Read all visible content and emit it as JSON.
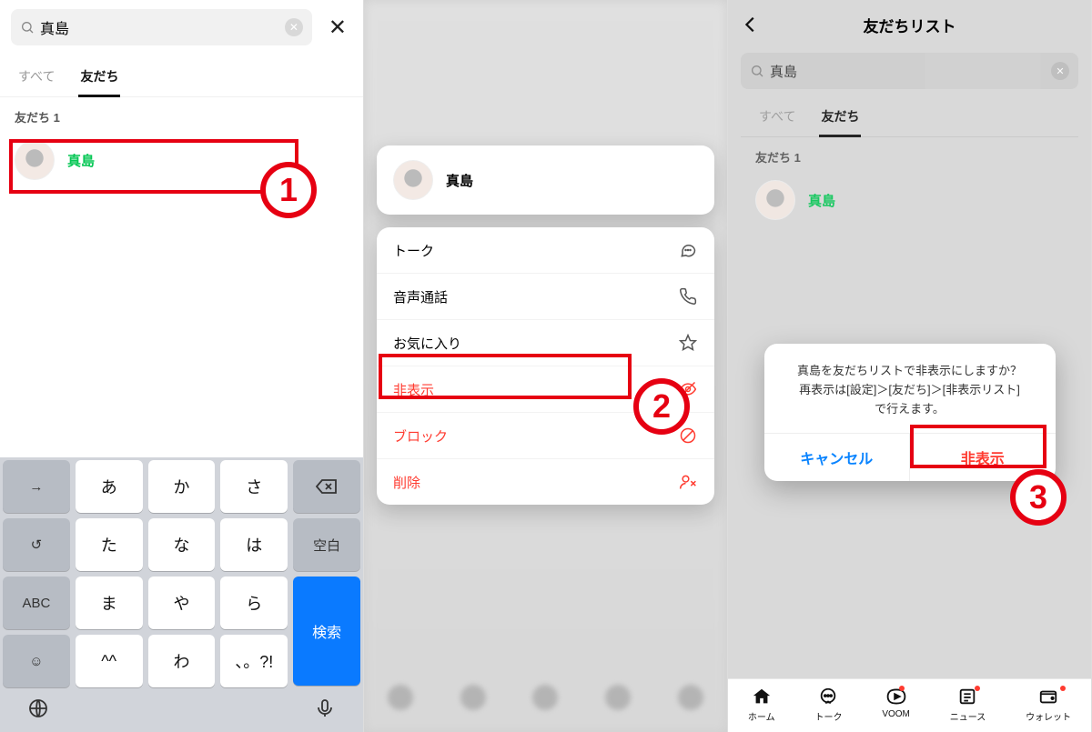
{
  "screen1": {
    "search_value": "真島",
    "tabs": {
      "all": "すべて",
      "friends": "友だち"
    },
    "section": "友だち 1",
    "friend_name": "真島",
    "annotation": "1",
    "keyboard": {
      "rows": [
        [
          "→",
          "あ",
          "か",
          "さ",
          "⌫"
        ],
        [
          "↺",
          "た",
          "な",
          "は",
          "空白"
        ],
        [
          "ABC",
          "ま",
          "や",
          "ら",
          "検索"
        ],
        [
          "☺",
          "^^",
          "わ",
          "、。?!",
          ""
        ]
      ],
      "globe": "🌐",
      "mic": "🎤"
    }
  },
  "screen2": {
    "friend_name": "真島",
    "menu": [
      {
        "label": "トーク",
        "icon": "chat",
        "danger": false
      },
      {
        "label": "音声通話",
        "icon": "phone",
        "danger": false
      },
      {
        "label": "お気に入り",
        "icon": "star",
        "danger": false
      },
      {
        "label": "非表示",
        "icon": "eye-off",
        "danger": true
      },
      {
        "label": "ブロック",
        "icon": "block",
        "danger": true
      },
      {
        "label": "削除",
        "icon": "user-x",
        "danger": true
      }
    ],
    "annotation": "2"
  },
  "screen3": {
    "header": "友だちリスト",
    "search_value": "真島",
    "tabs": {
      "all": "すべて",
      "friends": "友だち"
    },
    "section": "友だち 1",
    "friend_name": "真島",
    "dialog": {
      "line1": "真島を友だちリストで非表示にしますか？",
      "line2": "再表示は[設定]＞[友だち]＞[非表示リスト]",
      "line3": "で行えます。",
      "cancel": "キャンセル",
      "hide": "非表示"
    },
    "annotation": "3",
    "tabbar": [
      {
        "label": "ホーム",
        "icon": "home",
        "dot": false
      },
      {
        "label": "トーク",
        "icon": "chat",
        "dot": false
      },
      {
        "label": "VOOM",
        "icon": "play",
        "dot": true
      },
      {
        "label": "ニュース",
        "icon": "news",
        "dot": true
      },
      {
        "label": "ウォレット",
        "icon": "wallet",
        "dot": true
      }
    ]
  }
}
